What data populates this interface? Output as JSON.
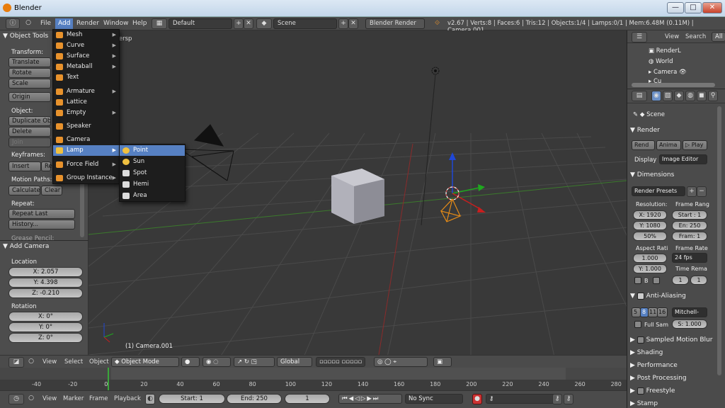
{
  "window": {
    "title": "Blender",
    "min": "—",
    "max": "□",
    "close": "✕"
  },
  "topbar": {
    "menus": [
      "File",
      "Add",
      "Render",
      "Window",
      "Help"
    ],
    "layout": "Default",
    "scene": "Scene",
    "engine": "Blender Render",
    "stats": "v2.67 | Verts:8 | Faces:6 | Tris:12 | Objects:1/4 | Lamps:0/1 | Mem:6.48M (0.11M) | Camera.001"
  },
  "toolshelf": {
    "title": "Object Tools",
    "transform_label": "Transform:",
    "translate": "Translate",
    "rotate": "Rotate",
    "scale": "Scale",
    "origin": "Origin",
    "object_label": "Object:",
    "duplicate": "Duplicate Objects",
    "delete": "Delete",
    "join": "Join",
    "keyframes_label": "Keyframes:",
    "insert": "Insert",
    "remove": "Re",
    "motion_label": "Motion Paths:",
    "calculate": "Calculate",
    "clear": "Clear",
    "repeat_label": "Repeat:",
    "repeat_last": "Repeat Last",
    "history": "History...",
    "grease": "Grease Pencil:",
    "add_camera": "Add Camera",
    "location_label": "Location",
    "loc_x": "X: 2.057",
    "loc_y": "Y: 4.398",
    "loc_z": "Z: -0.210",
    "rotation_label": "Rotation",
    "rot_x": "X: 0°",
    "rot_y": "Y: 0°",
    "rot_z": "Z: 0°"
  },
  "viewport": {
    "view_label": "User Persp",
    "object_label": "(1) Camera.001"
  },
  "add_menu": [
    {
      "label": "Mesh",
      "sub": true
    },
    {
      "label": "Curve",
      "sub": true
    },
    {
      "label": "Surface",
      "sub": true
    },
    {
      "label": "Metaball",
      "sub": true
    },
    {
      "label": "Text",
      "sub": false
    },
    {
      "label": "Armature",
      "sub": true
    },
    {
      "label": "Lattice",
      "sub": false
    },
    {
      "label": "Empty",
      "sub": true
    },
    {
      "label": "Speaker",
      "sub": false
    },
    {
      "label": "Camera",
      "sub": false
    },
    {
      "label": "Lamp",
      "sub": true
    },
    {
      "label": "Force Field",
      "sub": true
    },
    {
      "label": "Group Instance",
      "sub": true
    }
  ],
  "lamp_menu": [
    "Point",
    "Sun",
    "Spot",
    "Hemi",
    "Area"
  ],
  "outliner": {
    "view": "View",
    "search": "Search",
    "all": "All",
    "items": [
      "RenderL",
      "World",
      "Camera",
      "Cu"
    ]
  },
  "properties": {
    "scene": "Scene",
    "render": "Render",
    "render_btn": "Rend",
    "anim_btn": "Anima",
    "play_btn": "Play",
    "display_label": "Display",
    "display_value": "Image Editor",
    "dimensions": "Dimensions",
    "presets": "Render Presets",
    "resolution_label": "Resolution:",
    "frame_range_label": "Frame Rang",
    "res_x": "X: 1920",
    "res_y": "Y: 1080",
    "res_pct": "50%",
    "start": "Start : 1",
    "end": "En: 250",
    "fram": "Fram: 1",
    "aspect_label": "Aspect Rati",
    "frame_rate_label": "Frame Rate",
    "asp_x": "1.000",
    "asp_y": "Y: 1.000",
    "fps": "24 fps",
    "time_rem": "Time Rema",
    "b": "B",
    "t1": "1",
    "t2": "1",
    "aa": "Anti-Aliasing",
    "aa_5": "5",
    "aa_8": "8",
    "aa_11": "11",
    "aa_16": "16",
    "filter": "Mitchell-",
    "full_sample": "Full Sam",
    "size": "S: 1.000",
    "sampled_motion": "Sampled Motion Blur",
    "shading": "Shading",
    "performance": "Performance",
    "post": "Post Processing",
    "freestyle": "Freestyle",
    "stamp": "Stamp"
  },
  "vpheader": {
    "view": "View",
    "select": "Select",
    "object": "Object",
    "mode": "Object Mode",
    "orientation": "Global"
  },
  "timeline": {
    "ticks": [
      "-40",
      "-20",
      "0",
      "20",
      "40",
      "60",
      "80",
      "100",
      "120",
      "140",
      "160",
      "180",
      "200",
      "220",
      "240",
      "260",
      "280"
    ],
    "current_frame": 0
  },
  "tlheader": {
    "view": "View",
    "marker": "Marker",
    "frame": "Frame",
    "playback": "Playback",
    "start": "Start: 1",
    "end": "End: 250",
    "current": "1",
    "sync": "No Sync"
  }
}
